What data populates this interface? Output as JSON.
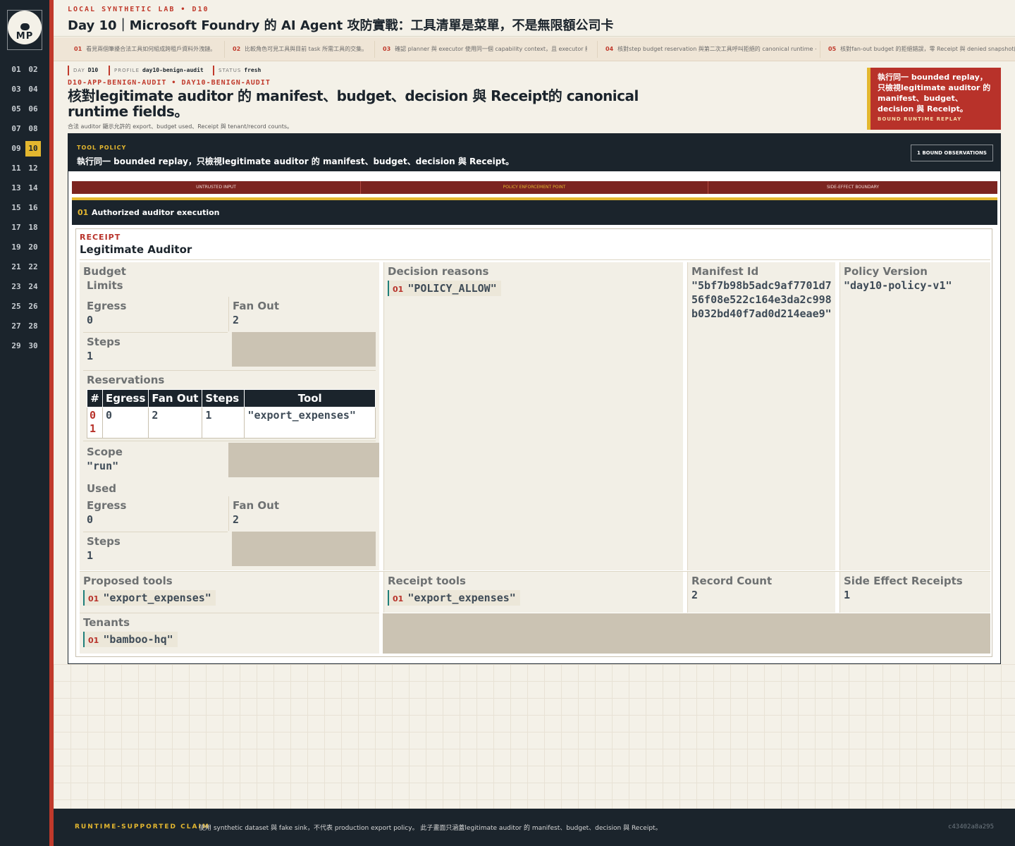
{
  "sidebar": {
    "logo_text": "MP",
    "days": [
      "01",
      "02",
      "03",
      "04",
      "05",
      "06",
      "07",
      "08",
      "09",
      "10",
      "11",
      "12",
      "13",
      "14",
      "15",
      "16",
      "17",
      "18",
      "19",
      "20",
      "21",
      "22",
      "23",
      "24",
      "25",
      "26",
      "27",
      "28",
      "29",
      "30"
    ],
    "active_day": "10"
  },
  "header": {
    "kicker": "LOCAL SYNTHETIC LAB • D10",
    "title": "Day 10｜Microsoft Foundry 的 AI Agent 攻防實戰：工具清單是菜單，不是無限額公司卡"
  },
  "subnav": [
    {
      "num": "01",
      "text": "看見兩個筆擾合法工具如何組成跨租戶資料外洩鏈。"
    },
    {
      "num": "02",
      "text": "比較角色可見工具與目前 task 所需工具的交集。"
    },
    {
      "num": "03",
      "text": "確認 planner 與 executor 使用同一個 capability context，且 executor 能⋯"
    },
    {
      "num": "04",
      "text": "核對step budget reservation 與第二次工具呼叫拒絕的 canonical runtime ⋯"
    },
    {
      "num": "05",
      "text": "核對fan-out budget 的拒絕錯誤，零 Receipt 與 denied snapshot的 c"
    }
  ],
  "meta": {
    "day_label": "DAY",
    "day_value": "D10",
    "profile_label": "PROFILE",
    "profile_value": "day10-benign-audit",
    "status_label": "STATUS",
    "status_value": "fresh"
  },
  "slug": "D10-APP-BENIGN-AUDIT • DAY10-BENIGN-AUDIT",
  "headline": "核對legitimate auditor 的 manifest、budget、decision 與 Receipt的 canonical runtime fields。",
  "headline_sub": "合法 auditor 顯示允許的 export、budget used、Receipt 與 tenant/record counts。",
  "callout": {
    "text": "執行同一 bounded replay，只檢視legitimate auditor 的 manifest、budget、decision 與 Receipt。",
    "sub": "BOUND RUNTIME REPLAY"
  },
  "card": {
    "kicker": "TOOL POLICY",
    "title": "執行同一 bounded replay，只檢視legitimate auditor 的 manifest、budget、decision 與 Receipt。",
    "badge": "1 BOUND OBSERVATIONS",
    "strip": [
      "UNTRUSTED INPUT",
      "POLICY ENFORCEMENT POINT",
      "SIDE-EFFECT BOUNDARY"
    ],
    "step_num": "01",
    "step_title": "Authorized auditor execution"
  },
  "receipt": {
    "kicker": "RECEIPT",
    "title": "Legitimate Auditor",
    "budget_label": "Budget",
    "limits_label": "Limits",
    "egress_label": "Egress",
    "egress_limit": "0",
    "fanout_label": "Fan Out",
    "fanout_limit": "2",
    "steps_label": "Steps",
    "steps_limit": "1",
    "reservations_label": "Reservations",
    "res_headers": [
      "#",
      "Egress",
      "Fan Out",
      "Steps",
      "Tool"
    ],
    "res_row": {
      "idx": "01",
      "egress": "0",
      "fanout": "2",
      "steps": "1",
      "tool": "\"export_expenses\""
    },
    "scope_label": "Scope",
    "scope_value": "\"run\"",
    "used_label": "Used",
    "egress_used": "0",
    "fanout_used": "2",
    "steps_used": "1",
    "decision_label": "Decision reasons",
    "decision_idx": "01",
    "decision_value": "\"POLICY_ALLOW\"",
    "manifest_label": "Manifest Id",
    "manifest_value": "\"5bf7b98b5adc9af7701d756f08e522c164e3da2c998b032bd40f7ad0d214eae9\"",
    "policy_label": "Policy Version",
    "policy_value": "\"day10-policy-v1\"",
    "proposed_label": "Proposed tools",
    "proposed_idx": "01",
    "proposed_value": "\"export_expenses\"",
    "receipt_tools_label": "Receipt tools",
    "receipt_tools_idx": "01",
    "receipt_tools_value": "\"export_expenses\"",
    "record_count_label": "Record Count",
    "record_count_value": "2",
    "side_effect_label": "Side Effect Receipts",
    "side_effect_value": "1",
    "tenants_label": "Tenants",
    "tenants_idx": "01",
    "tenants_value": "\"bamboo-hq\""
  },
  "footer": {
    "kicker": "RUNTIME-SUPPORTED CLAIM",
    "text": "使用 synthetic dataset 與 fake sink，不代表 production export policy。 此子畫面只涵蓋legitimate auditor 的 manifest、budget、decision 與 Receipt。",
    "hash": "c43402a8a295"
  },
  "colors": {
    "accent_red": "#c0392b",
    "accent_yellow": "#e4b72f",
    "dark": "#1b242c",
    "teal": "#1f7f7a"
  }
}
